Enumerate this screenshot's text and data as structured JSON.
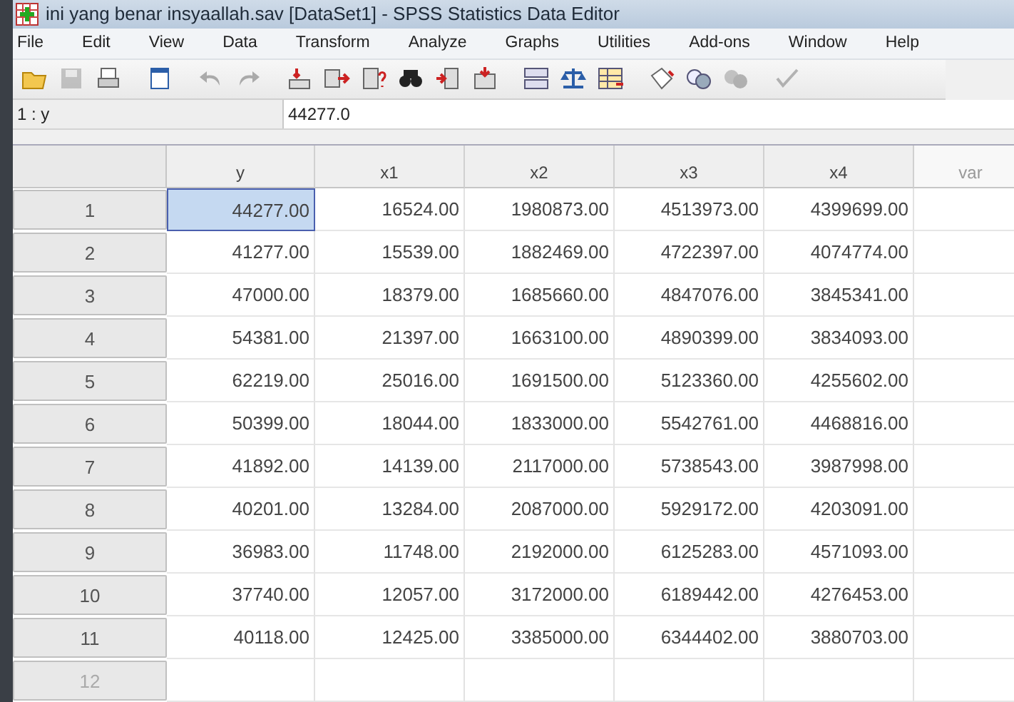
{
  "window": {
    "title": "ini yang benar insyaallah.sav [DataSet1] - SPSS Statistics Data Editor"
  },
  "menu": [
    "File",
    "Edit",
    "View",
    "Data",
    "Transform",
    "Analyze",
    "Graphs",
    "Utilities",
    "Add-ons",
    "Window",
    "Help"
  ],
  "toolbar": [
    {
      "kind": "open"
    },
    {
      "kind": "save",
      "disabled": true
    },
    {
      "kind": "print"
    },
    {
      "kind": "gap"
    },
    {
      "kind": "dialog"
    },
    {
      "kind": "gap"
    },
    {
      "kind": "undo",
      "disabled": true
    },
    {
      "kind": "redo",
      "disabled": true
    },
    {
      "kind": "gap"
    },
    {
      "kind": "goto-case"
    },
    {
      "kind": "goto-var"
    },
    {
      "kind": "variables"
    },
    {
      "kind": "find"
    },
    {
      "kind": "insert-case"
    },
    {
      "kind": "insert-var"
    },
    {
      "kind": "gap"
    },
    {
      "kind": "split"
    },
    {
      "kind": "weight"
    },
    {
      "kind": "select"
    },
    {
      "kind": "gap"
    },
    {
      "kind": "labels"
    },
    {
      "kind": "sets"
    },
    {
      "kind": "sets2",
      "disabled": true
    },
    {
      "kind": "gap"
    },
    {
      "kind": "spell",
      "disabled": true
    }
  ],
  "cell_editor": {
    "reference": "1 : y",
    "value": "44277.0"
  },
  "table": {
    "columns": [
      "y",
      "x1",
      "x2",
      "x3",
      "x4",
      "var"
    ],
    "rows": [
      {
        "label": "1",
        "enabled": true,
        "cells": [
          {
            "value": "44277.00",
            "selected": true
          },
          {
            "value": "16524.00",
            "selected": false
          },
          {
            "value": "1980873.00",
            "selected": false
          },
          {
            "value": "4513973.00",
            "selected": false
          },
          {
            "value": "4399699.00",
            "selected": false
          }
        ]
      },
      {
        "label": "2",
        "enabled": true,
        "cells": [
          {
            "value": "41277.00",
            "selected": false
          },
          {
            "value": "15539.00",
            "selected": false
          },
          {
            "value": "1882469.00",
            "selected": false
          },
          {
            "value": "4722397.00",
            "selected": false
          },
          {
            "value": "4074774.00",
            "selected": false
          }
        ]
      },
      {
        "label": "3",
        "enabled": true,
        "cells": [
          {
            "value": "47000.00",
            "selected": false
          },
          {
            "value": "18379.00",
            "selected": false
          },
          {
            "value": "1685660.00",
            "selected": false
          },
          {
            "value": "4847076.00",
            "selected": false
          },
          {
            "value": "3845341.00",
            "selected": false
          }
        ]
      },
      {
        "label": "4",
        "enabled": true,
        "cells": [
          {
            "value": "54381.00",
            "selected": false
          },
          {
            "value": "21397.00",
            "selected": false
          },
          {
            "value": "1663100.00",
            "selected": false
          },
          {
            "value": "4890399.00",
            "selected": false
          },
          {
            "value": "3834093.00",
            "selected": false
          }
        ]
      },
      {
        "label": "5",
        "enabled": true,
        "cells": [
          {
            "value": "62219.00",
            "selected": false
          },
          {
            "value": "25016.00",
            "selected": false
          },
          {
            "value": "1691500.00",
            "selected": false
          },
          {
            "value": "5123360.00",
            "selected": false
          },
          {
            "value": "4255602.00",
            "selected": false
          }
        ]
      },
      {
        "label": "6",
        "enabled": true,
        "cells": [
          {
            "value": "50399.00",
            "selected": false
          },
          {
            "value": "18044.00",
            "selected": false
          },
          {
            "value": "1833000.00",
            "selected": false
          },
          {
            "value": "5542761.00",
            "selected": false
          },
          {
            "value": "4468816.00",
            "selected": false
          }
        ]
      },
      {
        "label": "7",
        "enabled": true,
        "cells": [
          {
            "value": "41892.00",
            "selected": false
          },
          {
            "value": "14139.00",
            "selected": false
          },
          {
            "value": "2117000.00",
            "selected": false
          },
          {
            "value": "5738543.00",
            "selected": false
          },
          {
            "value": "3987998.00",
            "selected": false
          }
        ]
      },
      {
        "label": "8",
        "enabled": true,
        "cells": [
          {
            "value": "40201.00",
            "selected": false
          },
          {
            "value": "13284.00",
            "selected": false
          },
          {
            "value": "2087000.00",
            "selected": false
          },
          {
            "value": "5929172.00",
            "selected": false
          },
          {
            "value": "4203091.00",
            "selected": false
          }
        ]
      },
      {
        "label": "9",
        "enabled": true,
        "cells": [
          {
            "value": "36983.00",
            "selected": false
          },
          {
            "value": "11748.00",
            "selected": false
          },
          {
            "value": "2192000.00",
            "selected": false
          },
          {
            "value": "6125283.00",
            "selected": false
          },
          {
            "value": "4571093.00",
            "selected": false
          }
        ]
      },
      {
        "label": "10",
        "enabled": true,
        "cells": [
          {
            "value": "37740.00",
            "selected": false
          },
          {
            "value": "12057.00",
            "selected": false
          },
          {
            "value": "3172000.00",
            "selected": false
          },
          {
            "value": "6189442.00",
            "selected": false
          },
          {
            "value": "4276453.00",
            "selected": false
          }
        ]
      },
      {
        "label": "11",
        "enabled": true,
        "cells": [
          {
            "value": "40118.00",
            "selected": false
          },
          {
            "value": "12425.00",
            "selected": false
          },
          {
            "value": "3385000.00",
            "selected": false
          },
          {
            "value": "6344402.00",
            "selected": false
          },
          {
            "value": "3880703.00",
            "selected": false
          }
        ]
      },
      {
        "label": "12",
        "enabled": false
      }
    ]
  }
}
